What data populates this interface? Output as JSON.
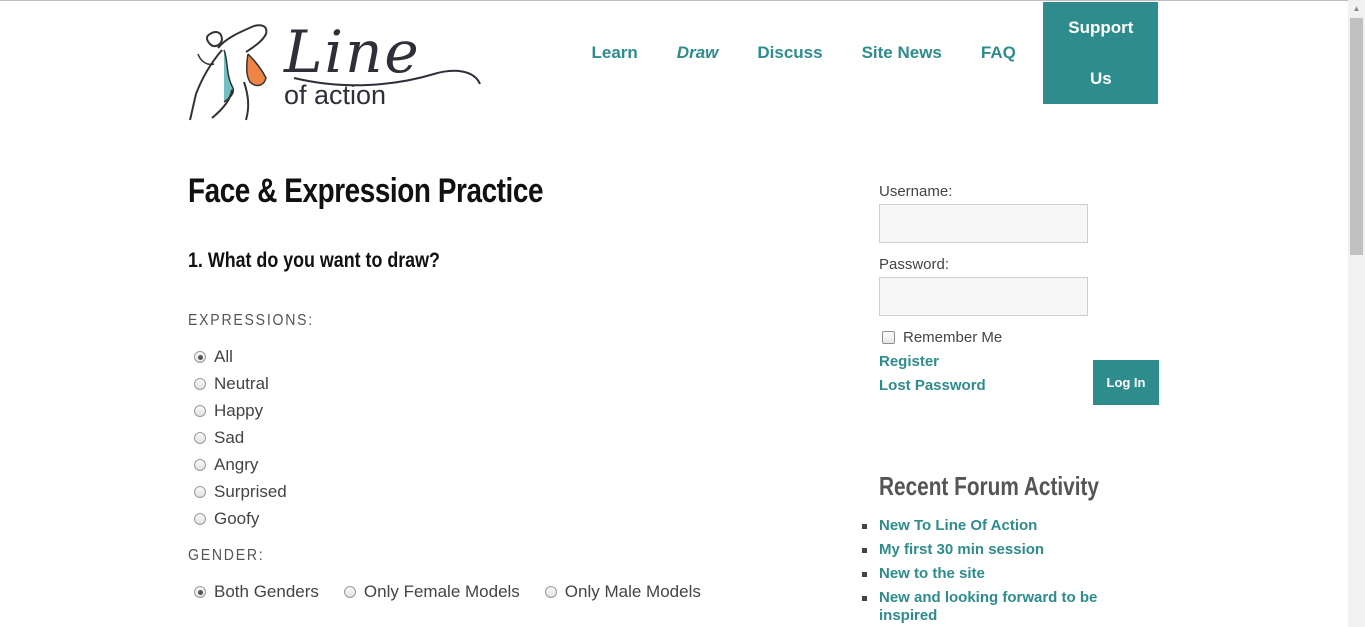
{
  "logo": {
    "line": "Line",
    "of_action": "of action"
  },
  "nav": [
    {
      "label": "Learn"
    },
    {
      "label": "Draw"
    },
    {
      "label": "Discuss"
    },
    {
      "label": "Site News"
    },
    {
      "label": "FAQ"
    },
    {
      "label": "Support Us"
    }
  ],
  "main": {
    "title": "Face & Expression Practice",
    "question": "1. What do you want to draw?",
    "expressions_label": "EXPRESSIONS:",
    "expressions": [
      {
        "label": "All",
        "checked": true
      },
      {
        "label": "Neutral",
        "checked": false
      },
      {
        "label": "Happy",
        "checked": false
      },
      {
        "label": "Sad",
        "checked": false
      },
      {
        "label": "Angry",
        "checked": false
      },
      {
        "label": "Surprised",
        "checked": false
      },
      {
        "label": "Goofy",
        "checked": false
      }
    ],
    "gender_label": "GENDER:",
    "genders": [
      {
        "label": "Both Genders",
        "checked": true
      },
      {
        "label": "Only Female Models",
        "checked": false
      },
      {
        "label": "Only Male Models",
        "checked": false
      }
    ]
  },
  "sidebar": {
    "username_label": "Username:",
    "username_value": "",
    "password_label": "Password:",
    "password_value": "",
    "remember_label": "Remember Me",
    "register_link": "Register",
    "lost_password_link": "Lost Password",
    "login_button": "Log In",
    "recent_title": "Recent Forum Activity",
    "recent_items": [
      "New To Line Of Action",
      "My first 30 min session",
      "New to the site",
      "New and looking forward to be inspired"
    ]
  },
  "colors": {
    "accent": "#2e8c8c",
    "text": "#333333"
  }
}
